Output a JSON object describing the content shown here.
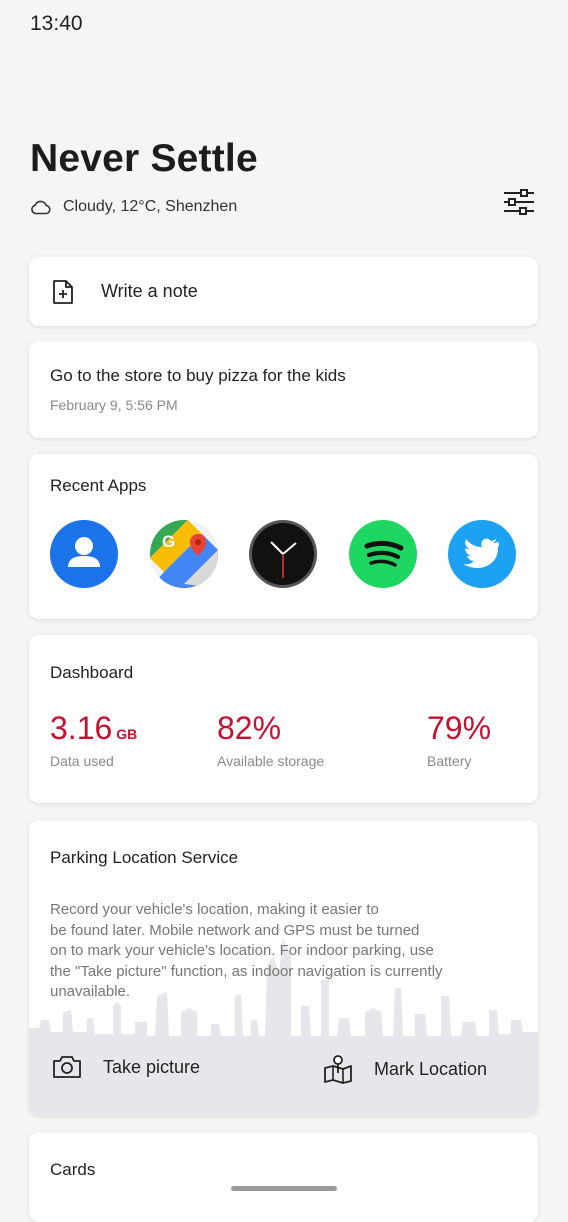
{
  "status_bar": {
    "time": "13:40"
  },
  "header": {
    "title": "Never Settle",
    "weather": "Cloudy, 12°C, Shenzhen",
    "weather_icon": "cloud-icon",
    "settings_icon": "sliders-icon"
  },
  "note_card": {
    "label": "Write a note",
    "icon": "note-add-icon"
  },
  "reminder": {
    "text": "Go to the store to buy pizza for the kids",
    "date": "February 9, 5:56 PM"
  },
  "recent_apps": {
    "heading": "Recent Apps",
    "apps": [
      {
        "name": "Contacts",
        "icon": "contacts-icon",
        "color": "#1a73e8"
      },
      {
        "name": "Maps",
        "icon": "maps-icon",
        "color": "#34a853"
      },
      {
        "name": "Clock",
        "icon": "clock-icon",
        "color": "#111111"
      },
      {
        "name": "Spotify",
        "icon": "spotify-icon",
        "color": "#1ed760"
      },
      {
        "name": "Twitter",
        "icon": "twitter-icon",
        "color": "#1da1f2"
      }
    ]
  },
  "dashboard": {
    "heading": "Dashboard",
    "accent": "#c8102e",
    "metrics": [
      {
        "value": "3.16",
        "unit": "GB",
        "caption": "Data used"
      },
      {
        "value": "82%",
        "unit": "",
        "caption": "Available storage"
      },
      {
        "value": "79%",
        "unit": "",
        "caption": "Battery"
      }
    ]
  },
  "parking": {
    "heading": "Parking Location Service",
    "description_lines": [
      "Record your vehicle's location, making it easier to",
      "be found later. Mobile network and GPS must be turned",
      "on to mark your vehicle's location. For indoor parking, use",
      "the \"Take picture\" function, as indoor navigation is currently",
      "unavailable."
    ],
    "take_picture": "Take picture",
    "mark_location": "Mark Location"
  },
  "cards": {
    "heading": "Cards"
  }
}
